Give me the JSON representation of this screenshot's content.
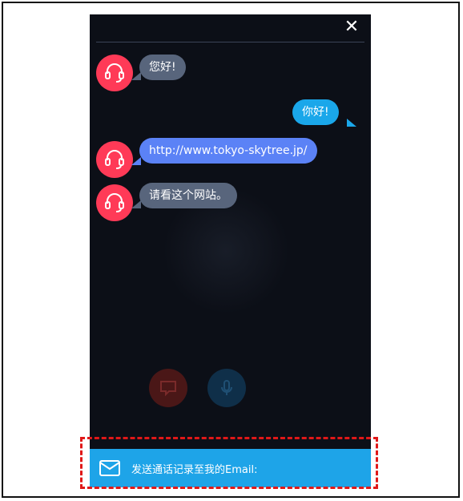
{
  "header": {
    "close_icon": "close-icon"
  },
  "messages": [
    {
      "sender": "agent",
      "text": "您好!"
    },
    {
      "sender": "user",
      "text": "你好!"
    },
    {
      "sender": "agent",
      "text": "http://www.tokyo-skytree.jp/"
    },
    {
      "sender": "agent",
      "text": "请看这个网站。"
    }
  ],
  "controls": {
    "chat_icon": "chat-icon",
    "mic_icon": "microphone-icon"
  },
  "email_bar": {
    "icon": "mail-icon",
    "label": "发送通话记录至我的Email:"
  },
  "colors": {
    "background": "#0c0f17",
    "agent_avatar": "#ff3a57",
    "agent_bubble": "#58657c",
    "user_bubble": "#1aa7ea",
    "link_bubble": "#5b82f6",
    "email_bar": "#1ea4e8",
    "highlight": "#e01818"
  }
}
